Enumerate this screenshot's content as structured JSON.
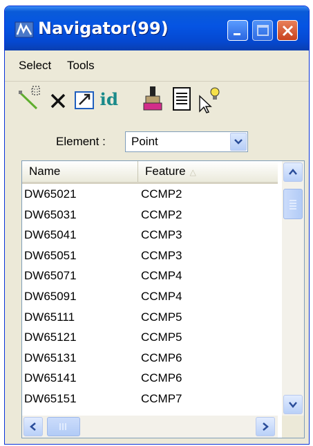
{
  "window": {
    "title": "Navigator(99)"
  },
  "menu": {
    "items": [
      "Select",
      "Tools"
    ]
  },
  "toolbar": {
    "tools": [
      "select-elements-icon",
      "delete-icon",
      "zoom-to-icon",
      "id-icon",
      "paint-brush-icon",
      "report-icon",
      "highlight-pointer-icon"
    ],
    "id_text": "id"
  },
  "filter": {
    "label": "Element :",
    "value": "Point"
  },
  "list": {
    "columns": [
      "Name",
      "Feature"
    ],
    "sorted_column": "Feature",
    "sort_direction": "ascending",
    "rows": [
      {
        "name": "DW65021",
        "feature": "CCMP2"
      },
      {
        "name": "DW65031",
        "feature": "CCMP2"
      },
      {
        "name": "DW65041",
        "feature": "CCMP3"
      },
      {
        "name": "DW65051",
        "feature": "CCMP3"
      },
      {
        "name": "DW65071",
        "feature": "CCMP4"
      },
      {
        "name": "DW65091",
        "feature": "CCMP4"
      },
      {
        "name": "DW65111",
        "feature": "CCMP5"
      },
      {
        "name": "DW65121",
        "feature": "CCMP5"
      },
      {
        "name": "DW65131",
        "feature": "CCMP6"
      },
      {
        "name": "DW65141",
        "feature": "CCMP6"
      },
      {
        "name": "DW65151",
        "feature": "CCMP7"
      }
    ]
  },
  "colors": {
    "titlebar": "#0554e3",
    "close_button": "#c8421e",
    "window_face": "#ece9d8"
  }
}
